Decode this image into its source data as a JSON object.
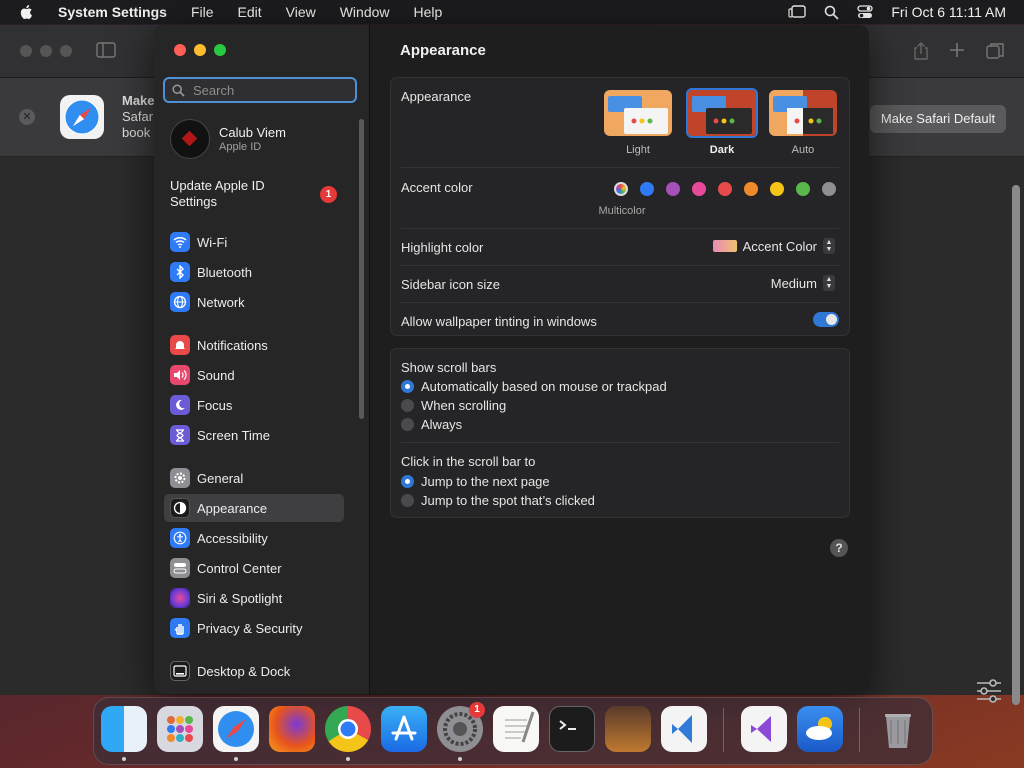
{
  "menubar": {
    "app_name": "System Settings",
    "menus": [
      "File",
      "Edit",
      "View",
      "Window",
      "Help"
    ],
    "clock": "Fri Oct 6  11:11 AM"
  },
  "safari": {
    "banner_title": "Make",
    "banner_line2": "Safar",
    "banner_line3": "book",
    "make_default_label": "Make Safari Default"
  },
  "sidebar": {
    "search_placeholder": "Search",
    "account": {
      "name": "Calub Viem",
      "sub": "Apple ID"
    },
    "update_label": "Update Apple ID Settings",
    "update_badge": "1",
    "items": [
      {
        "label": "Wi-Fi",
        "color": "#2f7bf5"
      },
      {
        "label": "Bluetooth",
        "color": "#2f7bf5"
      },
      {
        "label": "Network",
        "color": "#2f7bf5"
      },
      {
        "label": "Notifications",
        "color": "#e84a4a"
      },
      {
        "label": "Sound",
        "color": "#e8476e"
      },
      {
        "label": "Focus",
        "color": "#6a5bd6"
      },
      {
        "label": "Screen Time",
        "color": "#6a5bd6"
      },
      {
        "label": "General",
        "color": "#8e8e93"
      },
      {
        "label": "Appearance",
        "color": "#1c1c1c"
      },
      {
        "label": "Accessibility",
        "color": "#2f7bf5"
      },
      {
        "label": "Control Center",
        "color": "#8e8e93"
      },
      {
        "label": "Siri & Spotlight",
        "color": "#c04ad6"
      },
      {
        "label": "Privacy & Security",
        "color": "#2f7bf5"
      },
      {
        "label": "Desktop & Dock",
        "color": "#1c1c1c"
      }
    ],
    "selected": "Appearance"
  },
  "main": {
    "title": "Appearance",
    "appearance": {
      "label": "Appearance",
      "options": [
        "Light",
        "Dark",
        "Auto"
      ],
      "selected": "Dark"
    },
    "accent": {
      "label": "Accent color",
      "multicolor_label": "Multicolor",
      "colors": [
        "#8a60d8",
        "#2f7bf5",
        "#a650b8",
        "#e84a9a",
        "#e84a4a",
        "#f08a2a",
        "#f5c418",
        "#5ab84a",
        "#8e8e93"
      ]
    },
    "highlight": {
      "label": "Highlight color",
      "value": "Accent Color"
    },
    "icon_size": {
      "label": "Sidebar icon size",
      "value": "Medium"
    },
    "tinting": {
      "label": "Allow wallpaper tinting in windows",
      "on": true
    },
    "scroll_bars": {
      "label": "Show scroll bars",
      "options": [
        "Automatically based on mouse or trackpad",
        "When scrolling",
        "Always"
      ],
      "selected": 0
    },
    "click_scroll": {
      "label": "Click in the scroll bar to",
      "options": [
        "Jump to the next page",
        "Jump to the spot that’s clicked"
      ],
      "selected": 0
    },
    "help": "?"
  },
  "dock": {
    "apps": [
      "finder",
      "launchpad",
      "safari",
      "firefox",
      "chrome",
      "app-store",
      "system-settings",
      "textedit",
      "terminal",
      "garageband",
      "vscode",
      "visual-studio",
      "weather",
      "trash"
    ],
    "settings_badge": "1"
  }
}
